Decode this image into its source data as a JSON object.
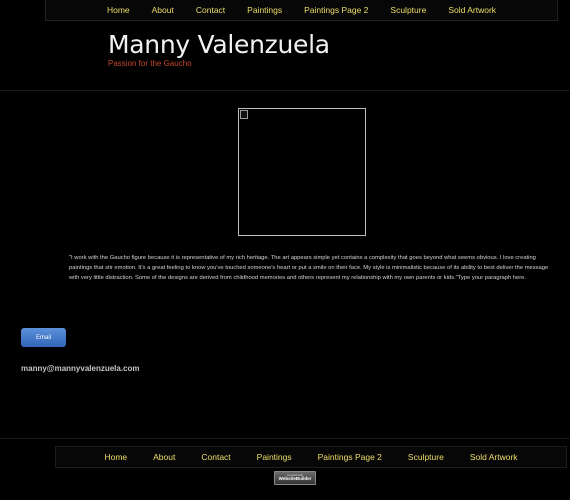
{
  "top_nav": {
    "items": [
      {
        "label": "Home"
      },
      {
        "label": "About"
      },
      {
        "label": "Contact"
      },
      {
        "label": "Paintings"
      },
      {
        "label": "Paintings Page 2"
      },
      {
        "label": "Sculpture"
      },
      {
        "label": "Sold Artwork"
      }
    ]
  },
  "header": {
    "title": "Manny Valenzuela",
    "tagline": "Passion for the Gaucho"
  },
  "main": {
    "statement": "\"I work with the Gaucho figure because it is representative of my rich heritage.  The art appears simple yet contains a complexity that goes beyond what seems obvious. I love creating paintings that stir emotion. It's a great feeling to know you've touched someone's heart or put a smile on their face. My style is minimalistic because of its ability to best deliver the message with very little distraction. Some of the designs are derived from childhood memories and others represent my relationship with my own parents or kids.\"Type your paragraph here.",
    "email_button_label": "Email",
    "email_address": "manny@mannyvalenzuela.com"
  },
  "bottom_nav": {
    "items": [
      {
        "label": "Home"
      },
      {
        "label": "About"
      },
      {
        "label": "Contact"
      },
      {
        "label": "Paintings"
      },
      {
        "label": "Paintings Page 2"
      },
      {
        "label": "Sculpture"
      },
      {
        "label": "Sold Artwork"
      }
    ]
  },
  "footer": {
    "badge_line1": "created with",
    "badge_line2": "WebsiteBuilder"
  },
  "colors": {
    "background": "#000000",
    "nav_link": "#f0df6a",
    "title": "#f2f2f2",
    "tagline": "#c2452a",
    "button": "#3d74c6"
  }
}
